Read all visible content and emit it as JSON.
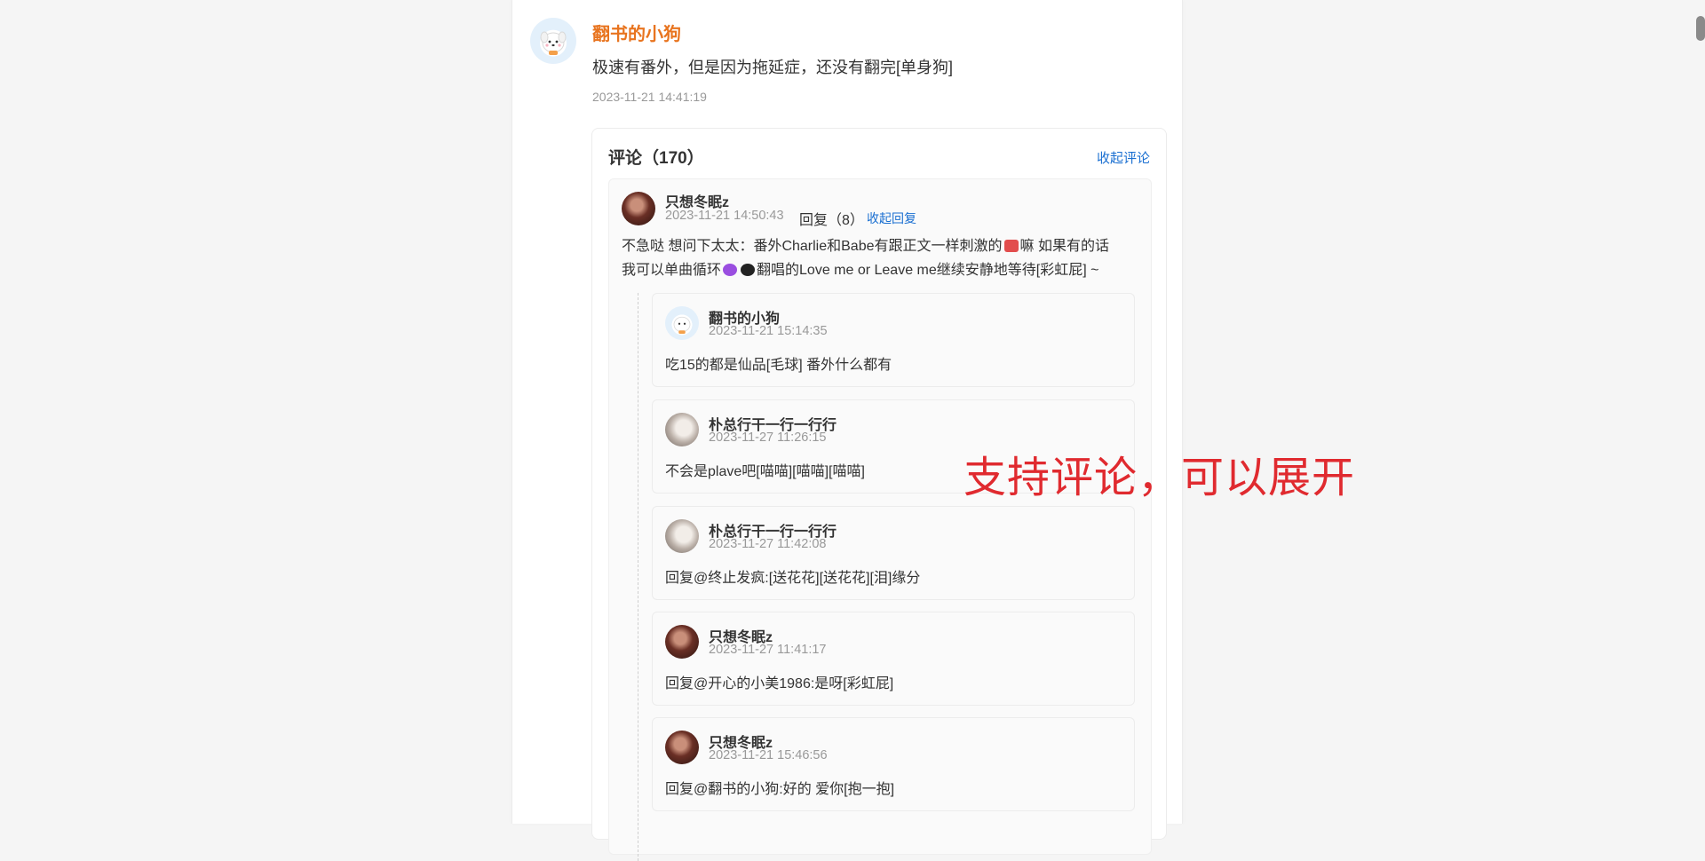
{
  "post": {
    "author": "翻书的小狗",
    "text": "极速有番外，但是因为拖延症，还没有翻完[单身狗]",
    "time": "2023-11-21 14:41:19"
  },
  "comments": {
    "title": "评论（170）",
    "collapse_label": "收起评论",
    "top_comment": {
      "name": "只想冬眠z",
      "time": "2023-11-21 14:50:43",
      "reply_count": "回复（8）",
      "collapse_replies": "收起回复",
      "text_line1": "不急哒 想问下太太：番外Charlie和Babe有跟正文一样刺激的",
      "text_line1_tail": "嘛 如果有的话",
      "text_line2_a": "我可以单曲循环",
      "text_line2_b": "翻唱的Love me or Leave me继续安静地等待[彩虹屁] ~"
    },
    "replies": [
      {
        "name": "翻书的小狗",
        "time": "2023-11-21 15:14:35",
        "text": "吃15的都是仙品[毛球] 番外什么都有",
        "avatar": "dog"
      },
      {
        "name": "朴总行干一行一行行",
        "time": "2023-11-27 11:26:15",
        "text": "不会是plave吧[喵喵][喵喵][喵喵]",
        "avatar": "cat"
      },
      {
        "name": "朴总行干一行一行行",
        "time": "2023-11-27 11:42:08",
        "text": "回复@终止发疯:[送花花][送花花][泪]缘分",
        "avatar": "cat"
      },
      {
        "name": "只想冬眠z",
        "time": "2023-11-27 11:41:17",
        "text": "回复@开心的小美1986:是呀[彩虹屁]",
        "avatar": "dark"
      },
      {
        "name": "只想冬眠z",
        "time": "2023-11-21 15:46:56",
        "text": "回复@翻书的小狗:好的 爱你[抱一抱]",
        "avatar": "dark"
      }
    ]
  },
  "annotation": "支持评论，可以展开",
  "colors": {
    "author_orange": "#e8741f",
    "link_blue": "#1a6fd1",
    "annotation_red": "#e02a2f"
  }
}
